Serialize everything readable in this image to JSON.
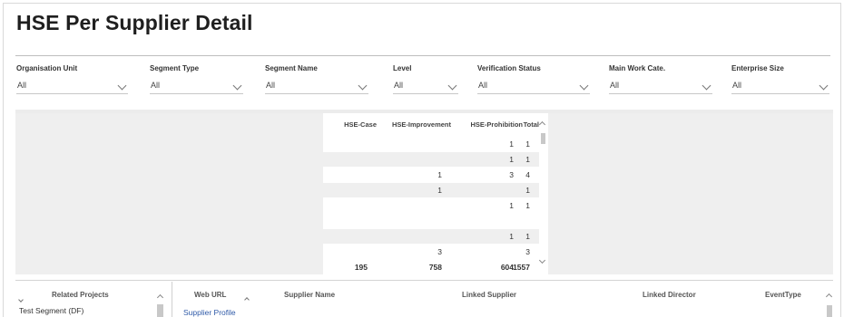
{
  "page": {
    "title": "HSE Per Supplier Detail"
  },
  "filters": [
    {
      "label": "Organisation Unit",
      "value": "All"
    },
    {
      "label": "Segment Type",
      "value": "All"
    },
    {
      "label": "Segment Name",
      "value": "All"
    },
    {
      "label": "Level",
      "value": "All"
    },
    {
      "label": "Verification Status",
      "value": "All"
    },
    {
      "label": "Main Work Cate.",
      "value": "All"
    },
    {
      "label": "Enterprise Size",
      "value": "All"
    }
  ],
  "matrix": {
    "columns": [
      "HSE-Case",
      "HSE-Improvement",
      "HSE-Prohibition",
      "Total"
    ],
    "rows": [
      [
        "",
        "",
        "1",
        "1"
      ],
      [
        "",
        "",
        "1",
        "1"
      ],
      [
        "",
        "1",
        "3",
        "4"
      ],
      [
        "",
        "1",
        "",
        "1"
      ],
      [
        "",
        "",
        "1",
        "1"
      ],
      [
        "",
        "",
        "",
        ""
      ],
      [
        "",
        "",
        "1",
        "1"
      ],
      [
        "",
        "3",
        "",
        "3"
      ]
    ],
    "totals": [
      "195",
      "758",
      "604",
      "1557"
    ]
  },
  "related_projects": {
    "header": "Related Projects",
    "items": [
      "Test Segment (DF)"
    ]
  },
  "detail_table": {
    "columns": [
      "Web URL",
      "Supplier Name",
      "Linked Supplier",
      "Linked Director",
      "EventType"
    ],
    "first_row_link": "Supplier Profile"
  }
}
